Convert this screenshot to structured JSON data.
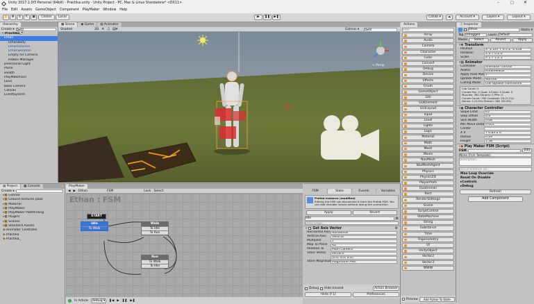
{
  "window": {
    "title": "Unity 2017.1.0f3 Personal (64bit) - Practika.unity - Unity Project - PC, Mac & Linux Standalone* <DX11>"
  },
  "menu": [
    "File",
    "Edit",
    "Assets",
    "GameObject",
    "Component",
    "PlayMaker",
    "Window",
    "Help"
  ],
  "toolbar": {
    "center": "Center",
    "local": "Local",
    "collab": "Collab ▾",
    "account": "Account ▾",
    "layers": "Layers ▾",
    "layout": "Layout ▾"
  },
  "hierarchy": {
    "tab": "Hierarchy",
    "create": "Create ▾",
    "search": "Q▾All",
    "scene": "Practika_*",
    "items": [
      "Ethan",
      "EthanBody",
      "EthanGlasses",
      "EthanSkeleton",
      "Empty for Camera",
      "HitBox Manager",
      "Directional Light",
      "Plane",
      "Health",
      "PlayMakerGUI",
      "Lava",
      "Base Camera",
      "Canvas",
      "EventSystem"
    ]
  },
  "scene": {
    "tabs": [
      "Scene",
      "Game",
      "Animator"
    ],
    "shaded": "Shaded",
    "mode2d": "2D",
    "gizmos": "Gizmos ▾",
    "all": "Q▾All",
    "persp": "< Persp"
  },
  "actions": {
    "tab": "Actions",
    "search": "Filter",
    "items": [
      "Array",
      "Audio",
      "Camera",
      "Character",
      "Color",
      "Convert",
      "Debug",
      "Device",
      "Effects",
      "Enum",
      "GameObject",
      "GUI",
      "GUIElement",
      "GUILayout",
      "Input",
      "Level",
      "Lights",
      "Logic",
      "Material",
      "Math",
      "Mesh",
      "Movie",
      "NavMesh",
      "NavMeshAgent",
      "Physics",
      "Physics2D",
      "PlayerPrefs",
      "Quaternion",
      "Rect",
      "RenderSettings",
      "Scene",
      "ScriptControl",
      "StateMachine",
      "String",
      "Substance",
      "Time",
      "Trigonometry",
      "UI",
      "UnityObject",
      "Vector2",
      "Vector3",
      "WWW"
    ],
    "preview": "Preview",
    "add_to_state": "Add Action To State"
  },
  "inspector": {
    "tab": "Inspector",
    "name": "Ethan",
    "static": "Static ▾",
    "tag_label": "Tag",
    "tag": "Untagged",
    "layer_label": "Layer",
    "layer": "Default",
    "model_label": "Model",
    "select": "Select",
    "revert": "Revert",
    "apply": "Apply",
    "transform": {
      "title": "Transform",
      "rows": [
        {
          "k": "Position",
          "v": "X -1.147  Y 0.5   Z -2.418"
        },
        {
          "k": "Rotation",
          "v": "X 0      Y 0     Z 0"
        },
        {
          "k": "Scale",
          "v": "X 1      Y 1     Z 1"
        }
      ]
    },
    "animator": {
      "title": "Animator",
      "rows": [
        {
          "k": "Controller",
          "v": "Animator Control"
        },
        {
          "k": "Avatar",
          "v": "EthanAvatar"
        },
        {
          "k": "Apply Root Motion",
          "v": "✓"
        },
        {
          "k": "Update Mode",
          "v": "Normal"
        },
        {
          "k": "Culling Mode",
          "v": "Cull Update Transforms"
        }
      ],
      "info": [
        "Clip Count: 5",
        "Curves Pos: 0 Quat: 0 Euler: 0 Scale: 0",
        "Muscles: 390 Generic: 0 PPtr: 0",
        "Curves Count: 390 Constant: 20 (5.1%)",
        "Dense: 0 (0.0%) Stream: 362 (92.9%)"
      ]
    },
    "character_controller": {
      "title": "Character Controller",
      "rows": [
        {
          "k": "Slope Limit",
          "v": "45"
        },
        {
          "k": "Step Offset",
          "v": "0.3"
        },
        {
          "k": "Skin Width",
          "v": "0.08"
        },
        {
          "k": "Min Move Distance",
          "v": "0.001"
        },
        {
          "k": "Center",
          "v": ""
        },
        {
          "k": "X 0",
          "v": "Y 0.83   Z 0"
        },
        {
          "k": "Radius",
          "v": "0.29"
        },
        {
          "k": "Height",
          "v": "1.58"
        }
      ]
    },
    "fsm": {
      "title": "Play Maker FSM (Script)",
      "fsm_label": "FSM",
      "edit": "Edit",
      "template": "None (Fsm Template)",
      "desc_placeholder": "Description...",
      "doc_url": "Documentation Url...",
      "max_loop": "Max Loop Override",
      "reset": "Reset On Disable",
      "controls": "Controls",
      "debug": "Debug",
      "refresh": "Refresh"
    },
    "add_component": "Add Component"
  },
  "project": {
    "tabs": [
      "Project",
      "Console"
    ],
    "create": "Create ▾",
    "items": [
      "Gizmos",
      "Ground textures pack",
      "Material",
      "PlayMaker",
      "PlayMaker Pathfinding",
      "Plugins",
      "Scenes",
      "Standard Assets",
      "Animator Controller",
      "Practika",
      "Practika_"
    ]
  },
  "playmaker": {
    "tab": "PlayMaker",
    "breadcrumb": [
      "Ethan",
      "FSM",
      "Lock",
      "Select"
    ],
    "title": "Ethan : FSM",
    "start": "START",
    "states": [
      {
        "name": "Idle",
        "events": [
          "To Walk"
        ]
      },
      {
        "name": "Walk",
        "events": [
          "To Idle",
          "To Run"
        ]
      },
      {
        "name": "Run",
        "events": [
          "To Walk",
          "To Idle"
        ]
      }
    ],
    "bottom": {
      "in_article": "In Article",
      "debug": "Debug ▾"
    }
  },
  "fsm_inspector": {
    "tabs": [
      "FSM",
      "State",
      "Events",
      "Variables"
    ],
    "prefab_title": "Prefab Instance (modified)",
    "prefab_body": "Editing the FSM can disconnect it from the Prefab FSM. You can edit Variable Values without losing the connection.",
    "apply": "Apply",
    "revert": "Revert",
    "state_name": "Idle",
    "description": "Description...",
    "action_title": "Get Axis Vector",
    "rows": [
      {
        "k": "Horizontal Axis",
        "v": "Horizontal"
      },
      {
        "k": "Vertical Axis",
        "v": "Vertical"
      },
      {
        "k": "Multiplier",
        "v": "1"
      },
      {
        "k": "Map To Plane",
        "v": "XZ"
      },
      {
        "k": "Relative To",
        "v": "Main Camera"
      },
      {
        "k": "Store Vector",
        "v": "vector3"
      },
      {
        "k": "",
        "v": "(0.0, 0.0, 0.0)"
      },
      {
        "k": "Store Magnitude",
        "v": "Magnitude Axis"
      }
    ],
    "debug": "Debug",
    "hide_unused": "Hide Unused",
    "action_browser": "Action Browser",
    "hints": "Hints [F1]",
    "preferences": "Preferences"
  }
}
